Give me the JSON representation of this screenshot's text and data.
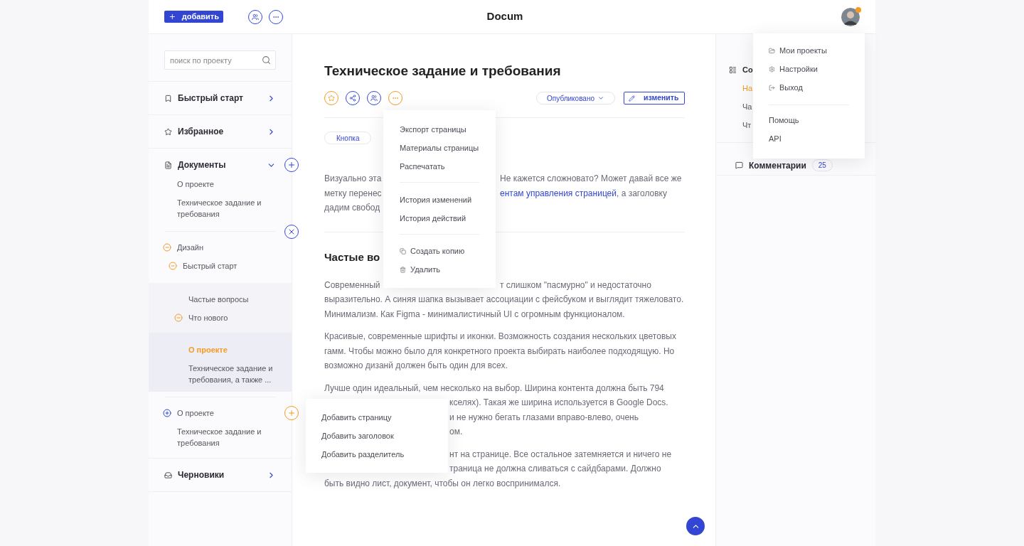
{
  "header": {
    "add_button": "добавить",
    "title": "Docum",
    "avatar": {
      "online": true
    },
    "user_menu": {
      "groups": [
        [
          {
            "label": "Мои проекты"
          },
          {
            "label": "Настройки"
          },
          {
            "label": "Выход"
          }
        ],
        [
          {
            "label": "Помощь"
          },
          {
            "label": "API"
          }
        ]
      ]
    }
  },
  "sidebar": {
    "search": {
      "placeholder": "поиск по проекту"
    },
    "sections": [
      {
        "label": "Быстрый старт",
        "expanded": false
      },
      {
        "label": "Избранное",
        "expanded": false
      },
      {
        "label": "Документы",
        "expanded": true,
        "groups": [
          {
            "items": [
              {
                "label": "О проекте",
                "selected": false
              },
              {
                "label": "Техническое задание и требования",
                "selected": false
              }
            ]
          },
          {
            "items": [
              {
                "label": "Дизайн",
                "selected": false,
                "expanded": true,
                "children": [
                  {
                    "label": "Быстрый старт",
                    "selected": false,
                    "expanded": true,
                    "children": [
                      {
                        "label": "Частые вопросы",
                        "selected": false
                      },
                      {
                        "label": "Что нового",
                        "selected": false,
                        "expanded": true,
                        "children": [
                          {
                            "label": "О проекте",
                            "selected": true
                          },
                          {
                            "label": "Техническое задание и требования, а также ...",
                            "selected": false
                          }
                        ]
                      }
                    ]
                  }
                ]
              }
            ]
          },
          {
            "items": [
              {
                "label": "О проекте",
                "selected": false,
                "expanded": false
              },
              {
                "label": "Техническое задание и требования",
                "selected": false
              }
            ],
            "add_menu": [
              {
                "label": "Добавить страницу"
              },
              {
                "label": "Добавить заголовок"
              },
              {
                "label": "Добавить разделитель"
              }
            ]
          }
        ]
      },
      {
        "label": "Черновики",
        "expanded": false
      }
    ]
  },
  "page": {
    "title": "Техническое задание и требования",
    "favorite": true,
    "status": "Опубликовано",
    "edit_button": "изменить",
    "page_menu": {
      "groups": [
        [
          {
            "label": "Экспорт страницы"
          },
          {
            "label": "Материалы страницы"
          },
          {
            "label": "Распечатать"
          }
        ],
        [
          {
            "label": "История изменений"
          },
          {
            "label": "История действий"
          }
        ],
        [
          {
            "label": "Создать копию"
          },
          {
            "label": "Удалить"
          }
        ]
      ]
    },
    "tags": [
      "Кнопка"
    ],
    "intro": [
      {
        "left": "Визуально эта",
        "right": "Не кажется сложновато? Может давай все же"
      },
      {
        "left": "метку перенес",
        "link": "ентам управления страницей",
        "right": ", а заголовку"
      },
      {
        "left": "дадим свобод"
      }
    ],
    "heading": "Частые во",
    "paragraphs": [
      [
        {
          "left": "Современный",
          "right": "т слишком \"пасмурно\" и недостаточно"
        },
        {
          "text": "выразительно. А синяя шапка вызывает ассоциации с фейсбуком и выглядит тяжеловато."
        },
        {
          "text": "Минимализм. Как Figma - минималистичный UI с огромным функционалом."
        }
      ],
      [
        {
          "text": "Красивые, современные шрифты и иконки. Возможность создания нескольких цветовых"
        },
        {
          "text": "гамм. Чтобы можно было для конкретного проекта выбирать наиболее подходящую. Но"
        },
        {
          "text": "возможно дизанй должен быть один для всех."
        }
      ],
      [
        {
          "text": "Лучше один идеальный, чем несколько на выбор. Ширина контента должна быть 794"
        },
        {
          "right": "кселях). Такая же ширина используется в Google Docs."
        },
        {
          "right": "и не нужно бегать глазами вправо-влево, очень"
        },
        {
          "right": "ом."
        }
      ],
      [
        {
          "right": "нт на странице. Все остальное затемняется и ничего не"
        },
        {
          "right": "траница не должна сливаться с сайдбарами. Должно"
        },
        {
          "text": "быть видно лист, документ, чтобы он легко воспринимался."
        }
      ]
    ]
  },
  "outline": {
    "title": "Со",
    "items": [
      {
        "label": "На",
        "selected": true
      },
      {
        "label": "Ча",
        "selected": false
      },
      {
        "label": "Чт",
        "selected": false
      }
    ],
    "comments": {
      "label": "Комментарии",
      "count": "25"
    }
  }
}
